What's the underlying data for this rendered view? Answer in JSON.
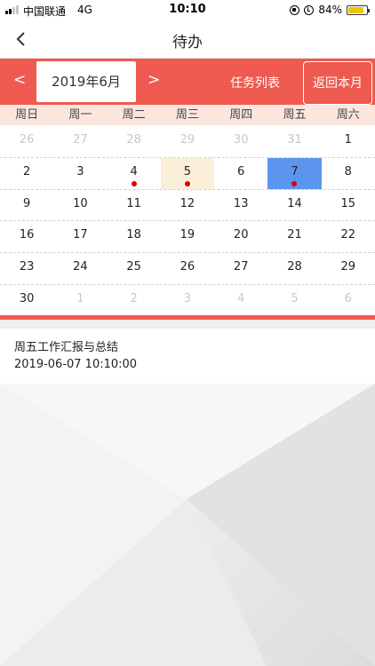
{
  "status_bar": {
    "carrier": "中国联通",
    "network": "4G",
    "time": "10:10",
    "battery": "84%",
    "battery_level": 0.84,
    "battery_color": "#f2c200"
  },
  "nav": {
    "back_icon": "chevron-left-icon",
    "title": "待办"
  },
  "calendar_header": {
    "prev_label": "<",
    "month_label": "2019年6月",
    "next_label": ">",
    "task_list_label": "任务列表",
    "back_to_month_label": "返回本月",
    "accent_color": "#ef5a50"
  },
  "weekdays": [
    "周日",
    "周一",
    "周二",
    "周三",
    "周四",
    "周五",
    "周六"
  ],
  "calendar": {
    "today_color": "#fbefd9",
    "selected_color": "#5b95ee",
    "dot_color": "#d90000",
    "weeks": [
      [
        {
          "d": "26",
          "dim": true
        },
        {
          "d": "27",
          "dim": true
        },
        {
          "d": "28",
          "dim": true
        },
        {
          "d": "29",
          "dim": true
        },
        {
          "d": "30",
          "dim": true
        },
        {
          "d": "31",
          "dim": true
        },
        {
          "d": "1"
        }
      ],
      [
        {
          "d": "2"
        },
        {
          "d": "3"
        },
        {
          "d": "4",
          "dot": true
        },
        {
          "d": "5",
          "dot": true,
          "today": true
        },
        {
          "d": "6"
        },
        {
          "d": "7",
          "dot": true,
          "selected": true
        },
        {
          "d": "8"
        }
      ],
      [
        {
          "d": "9"
        },
        {
          "d": "10"
        },
        {
          "d": "11"
        },
        {
          "d": "12"
        },
        {
          "d": "13"
        },
        {
          "d": "14"
        },
        {
          "d": "15"
        }
      ],
      [
        {
          "d": "16"
        },
        {
          "d": "17"
        },
        {
          "d": "18"
        },
        {
          "d": "19"
        },
        {
          "d": "20"
        },
        {
          "d": "21"
        },
        {
          "d": "22"
        }
      ],
      [
        {
          "d": "23"
        },
        {
          "d": "24"
        },
        {
          "d": "25"
        },
        {
          "d": "26"
        },
        {
          "d": "27"
        },
        {
          "d": "28"
        },
        {
          "d": "29"
        }
      ],
      [
        {
          "d": "30"
        },
        {
          "d": "1",
          "dim": true
        },
        {
          "d": "2",
          "dim": true
        },
        {
          "d": "3",
          "dim": true
        },
        {
          "d": "4",
          "dim": true
        },
        {
          "d": "5",
          "dim": true
        },
        {
          "d": "6",
          "dim": true
        }
      ]
    ]
  },
  "tasks": [
    {
      "title": "周五工作汇报与总结",
      "time": "2019-06-07 10:10:00"
    }
  ]
}
